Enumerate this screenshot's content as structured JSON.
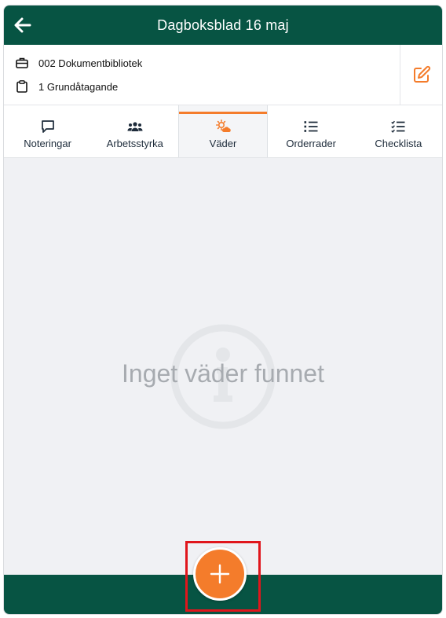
{
  "header": {
    "title": "Dagboksblad 16 maj"
  },
  "info": {
    "rows": [
      {
        "icon": "briefcase-icon",
        "text": "002 Dokumentbibliotek"
      },
      {
        "icon": "clipboard-icon",
        "text": "1 Grundåtagande"
      }
    ]
  },
  "tabs": [
    {
      "label": "Noteringar",
      "icon": "speech-bubble-icon"
    },
    {
      "label": "Arbetsstyrka",
      "icon": "users-icon"
    },
    {
      "label": "Väder",
      "icon": "weather-icon",
      "active": true
    },
    {
      "label": "Orderrader",
      "icon": "list-icon"
    },
    {
      "label": "Checklista",
      "icon": "checklist-icon"
    }
  ],
  "content": {
    "empty_text": "Inget väder funnet"
  },
  "colors": {
    "brand": "#075443",
    "accent": "#f47c2b",
    "highlight": "#e0161c"
  }
}
